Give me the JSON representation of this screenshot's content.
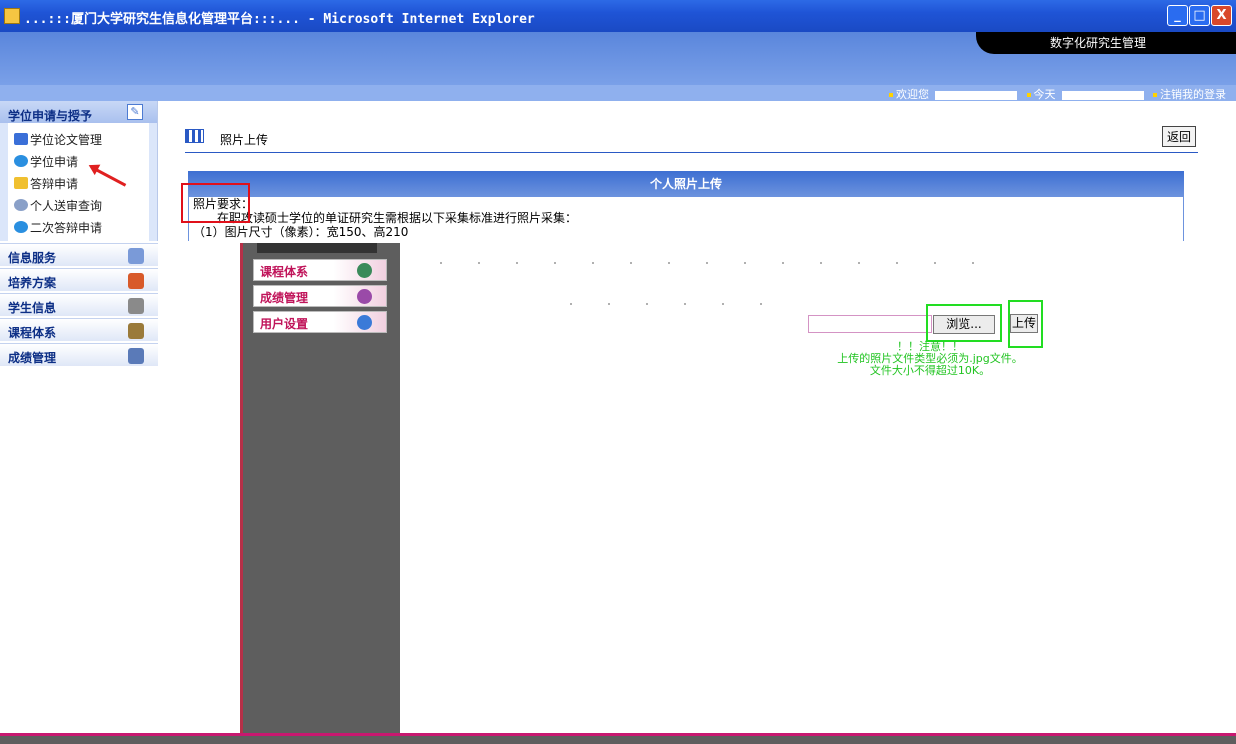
{
  "window": {
    "title": "...:::厦门大学研究生信息化管理平台:::... - Microsoft Internet Explorer",
    "controls": [
      "_",
      "□",
      "X"
    ]
  },
  "header": {
    "brand": "数字化研究生管理",
    "status": {
      "welcome": "欢迎您",
      "today": "今天",
      "logout": "注销我的登录"
    }
  },
  "sidebar": {
    "section_title": "学位申请与授予",
    "items": [
      {
        "label": "学位论文管理",
        "icon": "document-check-icon",
        "color": "#3a6fd8"
      },
      {
        "label": "学位申请",
        "icon": "globe-icon",
        "color": "#2a8fe0"
      },
      {
        "label": "答辩申请",
        "icon": "folder-icon",
        "color": "#f0c030"
      },
      {
        "label": "个人送审查询",
        "icon": "search-people-icon",
        "color": "#8aa0c8"
      },
      {
        "label": "二次答辩申请",
        "icon": "globe-icon",
        "color": "#2a8fe0"
      }
    ],
    "categories": [
      {
        "label": "信息服务",
        "icon": "person-icon",
        "color": "#7a9ad8"
      },
      {
        "label": "培养方案",
        "icon": "book-icon",
        "color": "#d85a2a"
      },
      {
        "label": "学生信息",
        "icon": "pencil-icon",
        "color": "#8a8a8a"
      },
      {
        "label": "课程体系",
        "icon": "paint-icon",
        "color": "#9a7a3a"
      },
      {
        "label": "成绩管理",
        "icon": "magnifier-icon",
        "color": "#5a7ab8"
      }
    ]
  },
  "submenu": {
    "items": [
      {
        "label": "课程体系",
        "icon": "globe-icon",
        "color": "#3a8a5a"
      },
      {
        "label": "成绩管理",
        "icon": "chart-icon",
        "color": "#9a4aa8"
      },
      {
        "label": "用户设置",
        "icon": "user-icon",
        "color": "#3a7ad8"
      }
    ]
  },
  "main": {
    "page_title": "照片上传",
    "back_label": "返回",
    "section_title": "个人照片上传",
    "requirements_title": "照片要求：",
    "requirements_line1": "在职攻读硕士学位的单证研究生需根据以下采集标准进行照片采集：",
    "requirements_line2": "（1）图片尺寸（像素）：宽150、高210"
  },
  "upload": {
    "browse_label": "浏览...",
    "upload_label": "上传",
    "note_title": "！！注意！！",
    "note_line1": "上传的照片文件类型必须为.jpg文件。",
    "note_line2": "文件大小不得超过10K。"
  }
}
